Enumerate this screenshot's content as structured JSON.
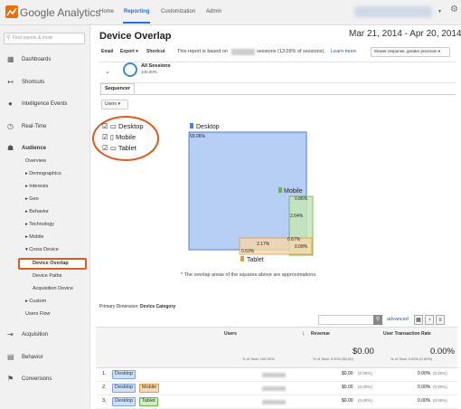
{
  "app": {
    "title": "Google Analytics",
    "colors": {
      "accent": "#1a73e8",
      "highlight": "#e05a1e"
    }
  },
  "topnav": [
    "Home",
    "Reporting",
    "Customization",
    "Admin"
  ],
  "sidebar": {
    "search_placeholder": "Find reports & more",
    "items": [
      "Dashboards",
      "Shortcuts",
      "Intelligence Events",
      "Real-Time",
      "Audience"
    ],
    "audience_sub": [
      "Overview",
      "▸ Demographics",
      "▸ Interests",
      "▸ Geo",
      "▸ Behavior",
      "▸ Technology",
      "▸ Mobile",
      "▾ Cross Device",
      "Device Overlap",
      "Device Paths",
      "Acquisition Device",
      "▸ Custom",
      "Users Flow"
    ],
    "bottom": [
      "Acquisition",
      "Behavior",
      "Conversions"
    ]
  },
  "report": {
    "title": "Device Overlap",
    "date_range": "Mar 21, 2014 - Apr 20, 2014",
    "actions": [
      "Email",
      "Export ▾",
      "Shortcut"
    ],
    "note_prefix": "This report is based on",
    "note_suffix": "sessions (13.09% of sessions).",
    "learn_more": "Learn more",
    "response": "Slower response, greater precision",
    "segment_name": "All Sessions",
    "segment_pct": "100.00%",
    "tab": "Sequencer",
    "users_dd": "Users",
    "devices": [
      "Desktop",
      "Mobile",
      "Tablet"
    ],
    "footnote": "* The overlap areas of the squares above are approximations.",
    "primary_dim_label": "Primary Dimension:",
    "primary_dim": "Device Category",
    "advanced": "advanced"
  },
  "venn": {
    "labels": [
      "Desktop",
      "Mobile",
      "Tablet"
    ],
    "values": [
      "93.06%",
      "0.86%",
      "2.64%",
      "2.17%",
      "0.67%",
      "0.08%",
      "0.53%"
    ]
  },
  "table": {
    "headers": [
      "Users",
      "Revenue",
      "User Transaction Rate"
    ],
    "total_users_sub": "% of Total: 100.00%",
    "total_revenue": "$0.00",
    "total_revenue_sub": "% of Total: 0.00% ($0.00)",
    "total_rate": "0.00%",
    "total_rate_sub": "% of Total: 0.00% (0.00%)",
    "rows": [
      {
        "n": "1.",
        "chips": [
          "Desktop"
        ],
        "revenue": "$0.00",
        "rev_pct": "(0.00%)",
        "rate": "0.00%",
        "rate_pct": "(0.00%)"
      },
      {
        "n": "2.",
        "chips": [
          "Desktop",
          "Mobile"
        ],
        "revenue": "$0.00",
        "rev_pct": "(0.00%)",
        "rate": "0.00%",
        "rate_pct": "(0.00%)"
      },
      {
        "n": "3.",
        "chips": [
          "Desktop",
          "Tablet"
        ],
        "revenue": "$0.00",
        "rev_pct": "(0.00%)",
        "rate": "0.00%",
        "rate_pct": "(0.00%)"
      }
    ]
  }
}
